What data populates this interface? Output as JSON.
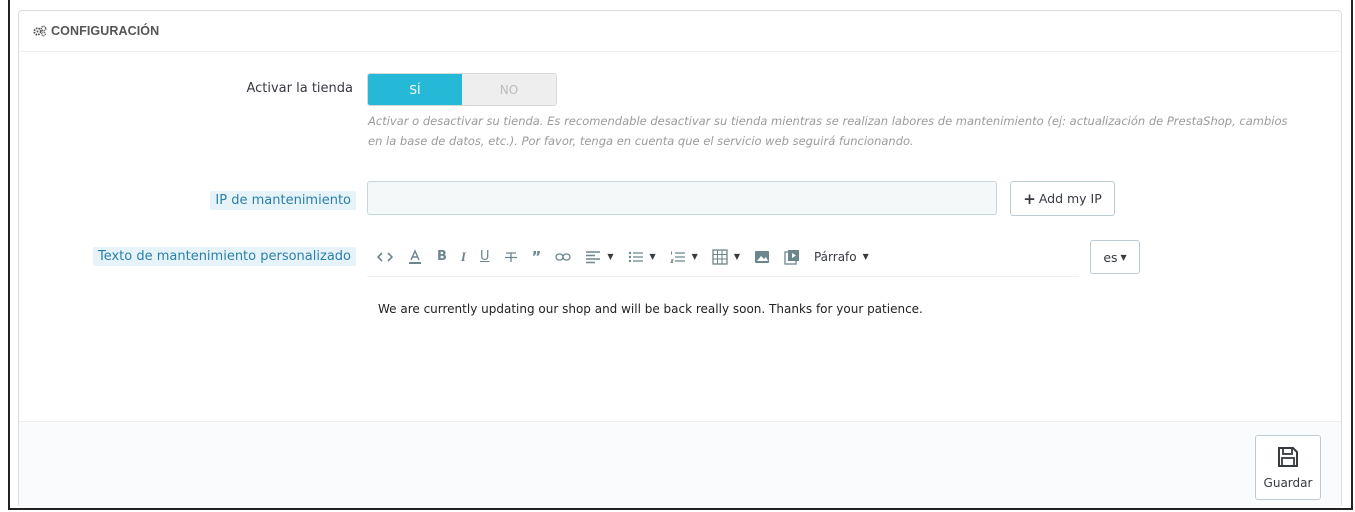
{
  "panel": {
    "title": "CONFIGURACIÓN",
    "title_icon": "cogs-icon"
  },
  "shop_toggle": {
    "label": "Activar la tienda",
    "yes_label": "SÍ",
    "no_label": "NO",
    "selected": "SÍ",
    "help": "Activar o desactivar su tienda. Es recomendable desactivar su tienda mientras se realizan labores de mantenimiento (ej: actualización de PrestaShop, cambios en la base de datos, etc.). Por favor, tenga en cuenta que el servicio web seguirá funcionando."
  },
  "maintenance_ip": {
    "label": "IP de mantenimiento",
    "value": "",
    "add_button": "Add my IP"
  },
  "maintenance_text": {
    "label": "Texto de mantenimiento personalizado",
    "paragraph_label": "Párrafo",
    "language": "es",
    "content": "We are currently updating our shop and will be back really soon. Thanks for your patience."
  },
  "footer": {
    "save_label": "Guardar"
  },
  "colors": {
    "accent": "#25b9d7",
    "label_highlight_bg": "#e6f4fa",
    "label_highlight_text": "#2a7fa9"
  }
}
